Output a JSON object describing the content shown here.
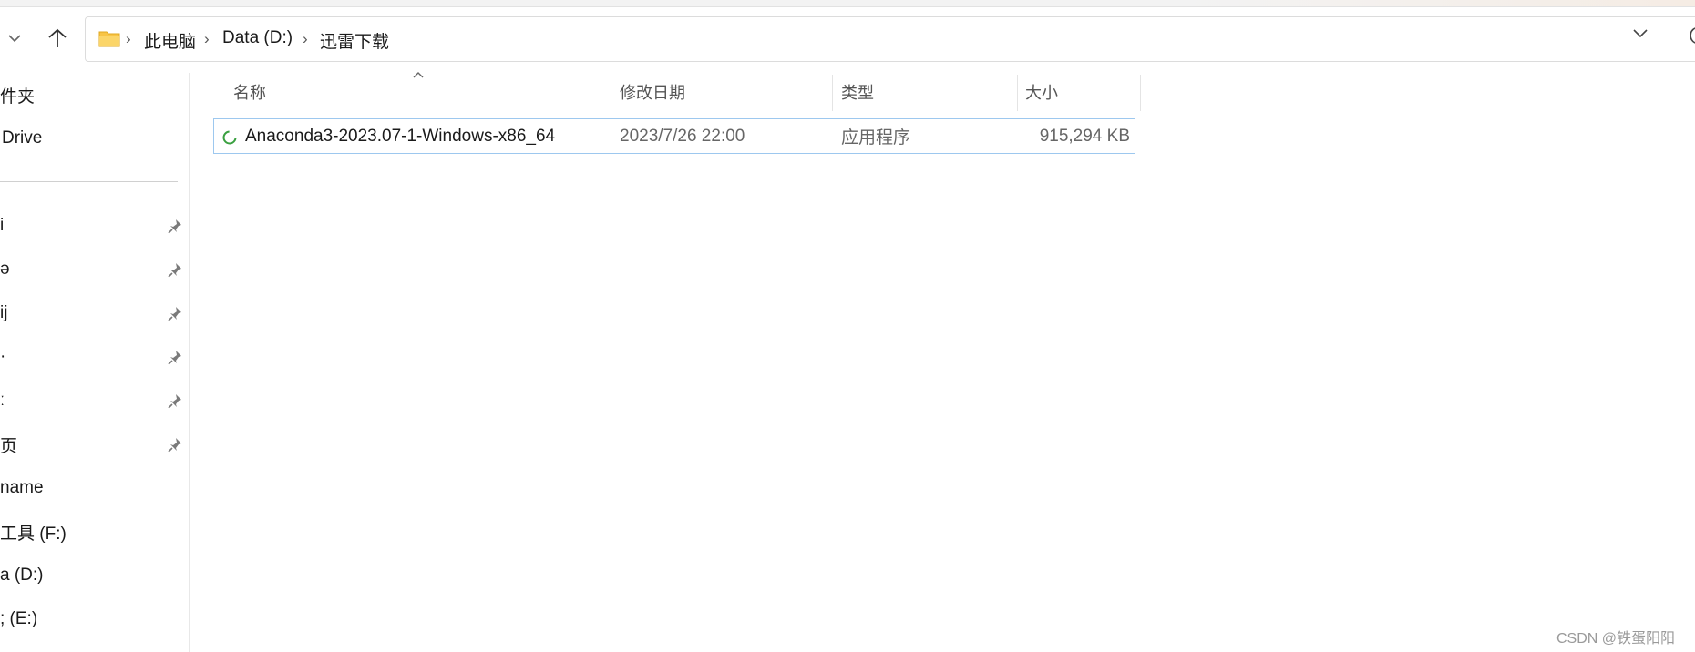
{
  "breadcrumb": {
    "items": [
      "此电脑",
      "Data (D:)",
      "迅雷下载"
    ]
  },
  "sidebar": {
    "top_items": [
      "件夹",
      "Drive"
    ],
    "pinned_items": [
      "i",
      "ǝ",
      "ij",
      "·",
      "ː",
      "页"
    ],
    "drives": [
      "name",
      "工具 (F:)",
      "a (D:)",
      "; (E:)"
    ]
  },
  "columns": {
    "name": "名称",
    "modified": "修改日期",
    "type": "类型",
    "size": "大小"
  },
  "files": [
    {
      "name": "Anaconda3-2023.07-1-Windows-x86_64",
      "modified": "2023/7/26 22:00",
      "type": "应用程序",
      "size": "915,294 KB",
      "icon": "loading-spinner-icon"
    }
  ],
  "watermark": "CSDN @铁蛋阳阳",
  "colors": {
    "selection_border": "#9dc8ef",
    "folder_yellow": "#f8c446",
    "spinner_green": "#3aa040"
  }
}
